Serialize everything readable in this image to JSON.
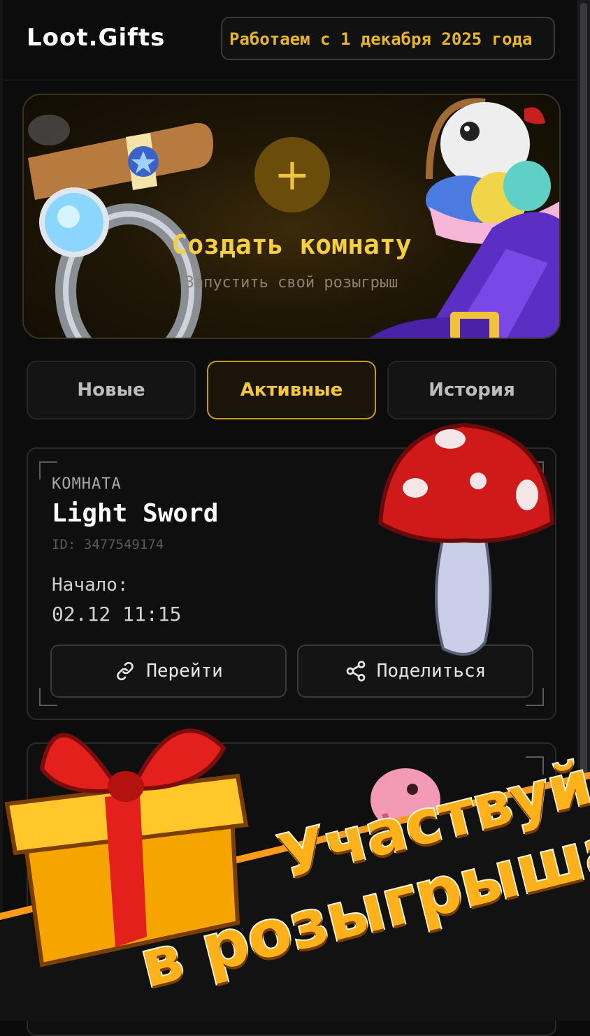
{
  "header": {
    "logo": "Loot.Gifts",
    "ticker": "Работаем с 1 декабря 2025 года"
  },
  "hero": {
    "plus_icon": "plus",
    "title": "Создать комнату",
    "subtitle": "Запустить свой розыгрыш"
  },
  "tabs": [
    {
      "label": "Новые",
      "active": false
    },
    {
      "label": "Активные",
      "active": true
    },
    {
      "label": "История",
      "active": false
    }
  ],
  "room": {
    "section_label": "КОМНАТА",
    "name": "Light Sword",
    "id": "ID: 3477549174",
    "start_label": "Начало:",
    "start_time": "02.12 11:15",
    "go_button": "Перейти",
    "share_button": "Поделиться"
  },
  "promo": {
    "line1": "Участвуй",
    "line2": "в розыгрышах"
  },
  "colors": {
    "accent": "#f4c83a",
    "background": "#0c0c0d",
    "promo": "#ffb11a"
  }
}
